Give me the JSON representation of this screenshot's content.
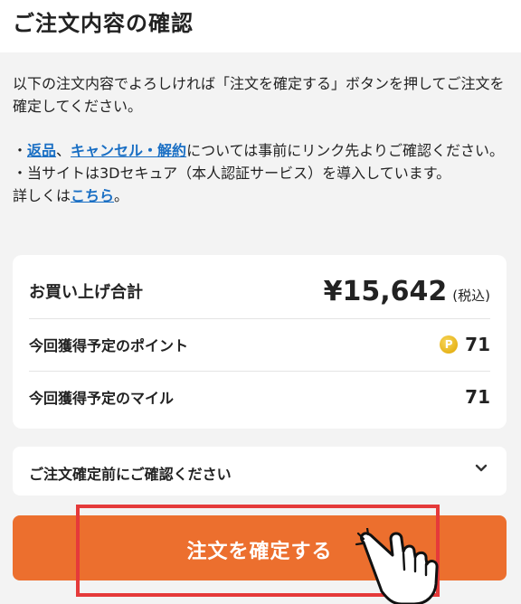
{
  "header": {
    "title": "ご注文内容の確認"
  },
  "notice": {
    "line1": "以下の注文内容でよろしければ「注文を確定する」ボタンを押してご注文を確定してください。",
    "line2_prefix": "・",
    "link_returns": "返品",
    "line2_sep": "、",
    "link_cancel": "キャンセル・解約",
    "line2_suffix": "については事前にリンク先よりご確認ください。",
    "line3": "・当サイトは3Dセキュア（本人認証サービス）を導入しています。",
    "line4_prefix": "詳しくは",
    "link_here": "こちら",
    "line4_suffix": "。"
  },
  "summary": {
    "total_label": "お買い上げ合計",
    "total_amount": "¥15,642",
    "tax_note": "(税込)",
    "points_label": "今回獲得予定のポイント",
    "points_icon": "point-coin-icon",
    "points_icon_glyph": "P",
    "points_value": "71",
    "miles_label": "今回獲得予定のマイル",
    "miles_value": "71"
  },
  "accordion": {
    "label": "ご注文確定前にご確認ください",
    "icon": "chevron-down-icon"
  },
  "confirm": {
    "label": "注文を確定する",
    "color": "#ec6f2e"
  },
  "overlay": {
    "highlight_color": "#e53a3a",
    "pointer_icon": "hand-pointer-icon"
  },
  "colors": {
    "accent": "#ec6f2e",
    "link": "#1a6fc4",
    "background": "#f3f3f3",
    "card": "#ffffff",
    "point_coin": "#e0a500"
  }
}
